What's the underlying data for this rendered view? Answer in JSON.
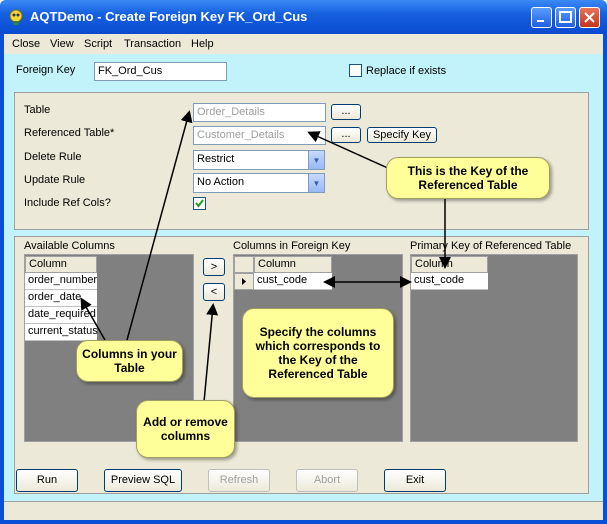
{
  "window": {
    "title": "AQTDemo - Create Foreign Key FK_Ord_Cus"
  },
  "menu": [
    "Close",
    "View",
    "Script",
    "Transaction",
    "Help"
  ],
  "foreign_key": {
    "label": "Foreign Key",
    "value": "FK_Ord_Cus",
    "replace_label": "Replace if exists",
    "replace_checked": false
  },
  "form": {
    "table_label": "Table",
    "table_value": "Order_Details",
    "ref_table_label": "Referenced Table*",
    "ref_table_value": "Customer_Details",
    "browse_label": "...",
    "specify_key_label": "Specify Key",
    "delete_rule_label": "Delete Rule",
    "delete_rule_value": "Restrict",
    "update_rule_label": "Update Rule",
    "update_rule_value": "No Action",
    "include_ref_label": "Include Ref Cols?",
    "include_ref_checked": true
  },
  "available": {
    "title": "Available Columns",
    "header": "Column",
    "rows": [
      "order_number",
      "order_date",
      "date_required",
      "current_status"
    ]
  },
  "fk_columns": {
    "title": "Columns in Foreign Key",
    "header": "Column",
    "rows": [
      "cust_code"
    ]
  },
  "pk_columns": {
    "title": "Primary Key of Referenced Table",
    "header": "Column",
    "rows": [
      "cust_code"
    ]
  },
  "move": {
    "add": ">",
    "remove": "<"
  },
  "buttons": {
    "run": "Run",
    "preview": "Preview SQL",
    "refresh": "Refresh",
    "abort": "Abort",
    "exit": "Exit"
  },
  "callouts": {
    "key": "This is the Key of the Referenced Table",
    "columns": "Columns in your Table",
    "specify": "Specify the columns which corresponds to the Key of the Referenced Table",
    "addremove": "Add or remove columns"
  },
  "colors": {
    "title_bar": "#0a4fd6",
    "client": "#c3f3fa",
    "panel": "#ece9d8",
    "note": "#ffff99"
  }
}
